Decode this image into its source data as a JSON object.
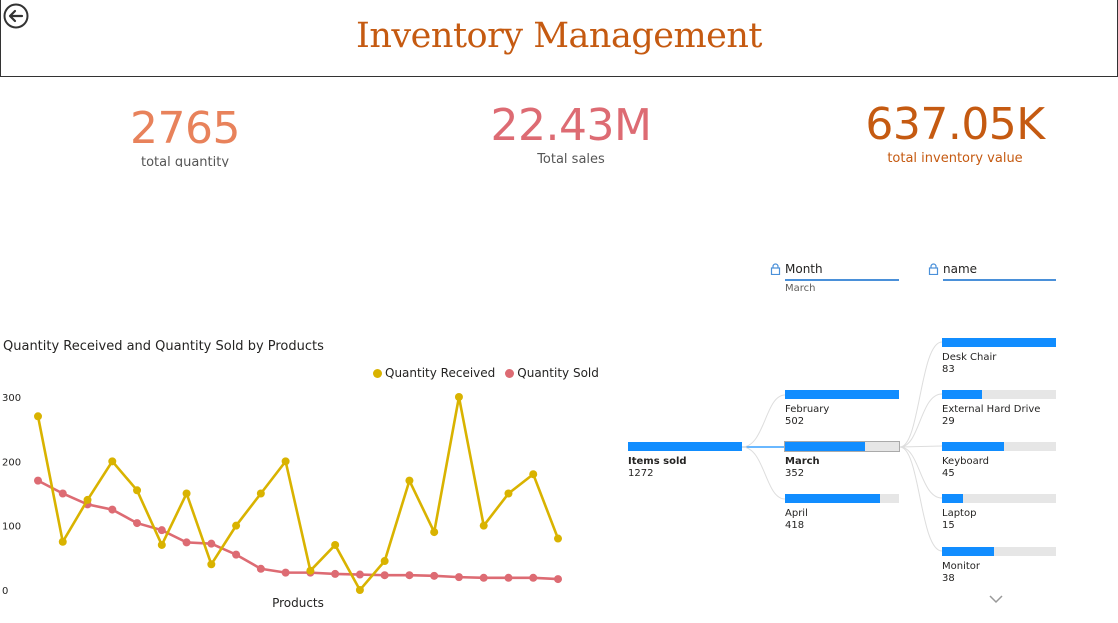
{
  "header": {
    "title": "Inventory Management"
  },
  "kpis": [
    {
      "value": "2765",
      "label": "total quantity",
      "color": "#e8825b"
    },
    {
      "value": "22.43M",
      "label": "Total sales",
      "color": "#dd6b73"
    },
    {
      "value": "637.05K",
      "label": "total inventory value",
      "color": "#c55a11"
    }
  ],
  "chart_data": {
    "type": "line",
    "title": "Quantity Received and Quantity Sold by Products",
    "xlabel": "Products",
    "ylabel": "",
    "ylim": [
      0,
      300
    ],
    "yticks": [
      "0",
      "100",
      "200",
      "300"
    ],
    "legend_position": "top-right",
    "series": [
      {
        "name": "Quantity Received",
        "color": "#d9b300",
        "values": [
          270,
          75,
          140,
          200,
          155,
          70,
          150,
          40,
          100,
          150,
          200,
          30,
          70,
          0,
          45,
          170,
          90,
          300,
          100,
          150,
          180,
          80
        ]
      },
      {
        "name": "Quantity Sold",
        "color": "#dd6b73",
        "values": [
          170,
          150,
          133,
          125,
          104,
          93,
          74,
          72,
          55,
          33,
          27,
          27,
          25,
          24,
          23,
          23,
          22,
          20,
          19,
          19,
          19,
          17
        ]
      }
    ]
  },
  "tree": {
    "month_header": "Month",
    "month_selected": "March",
    "name_header": "name",
    "root": {
      "label": "Items sold",
      "value": "1272",
      "fraction": 1.0
    },
    "months": [
      {
        "label": "February",
        "value": "502",
        "fraction": 1.0
      },
      {
        "label": "March",
        "value": "352",
        "fraction": 0.7,
        "selected": true
      },
      {
        "label": "April",
        "value": "418",
        "fraction": 0.83
      }
    ],
    "names": [
      {
        "label": "Desk Chair",
        "value": "83",
        "fraction": 1.0
      },
      {
        "label": "External Hard Drive",
        "value": "29",
        "fraction": 0.35
      },
      {
        "label": "Keyboard",
        "value": "45",
        "fraction": 0.54
      },
      {
        "label": "Laptop",
        "value": "15",
        "fraction": 0.18
      },
      {
        "label": "Monitor",
        "value": "38",
        "fraction": 0.46
      }
    ],
    "bar_color": "#118dff"
  }
}
